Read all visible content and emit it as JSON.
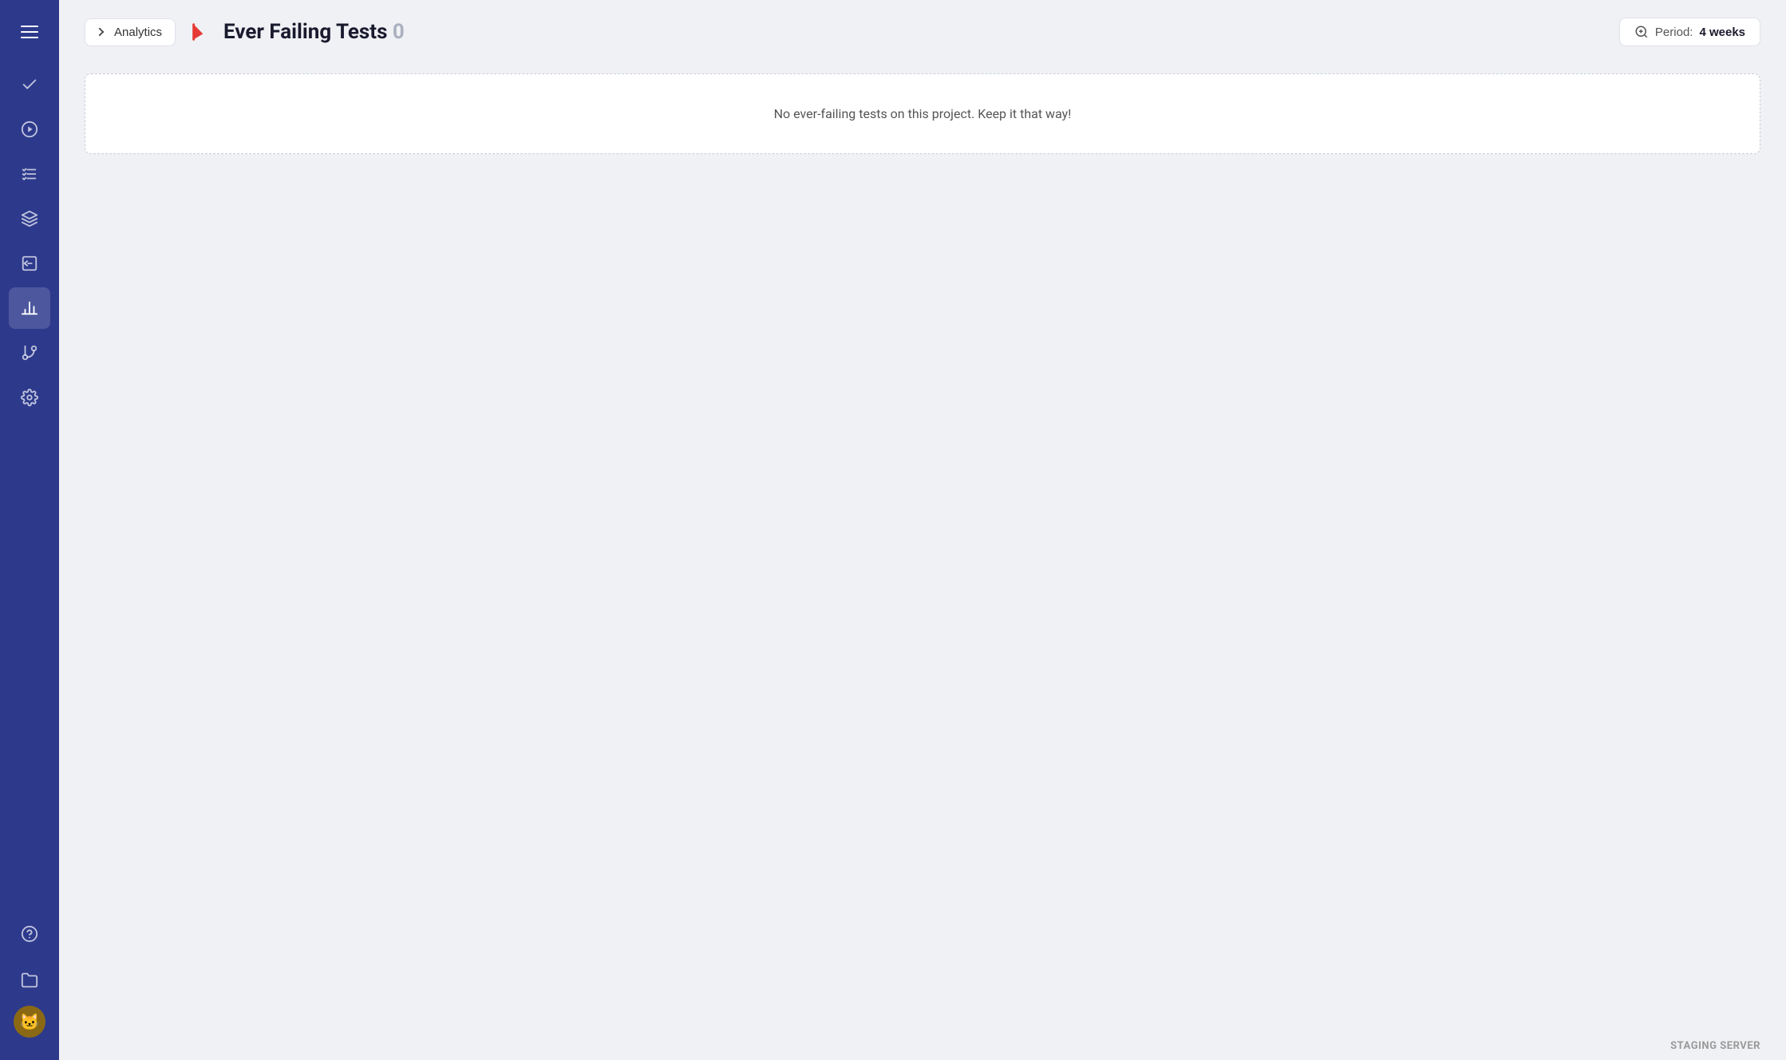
{
  "sidebar": {
    "items": [
      {
        "name": "check-icon",
        "label": "Tests",
        "active": false
      },
      {
        "name": "play-icon",
        "label": "Run",
        "active": false
      },
      {
        "name": "list-check-icon",
        "label": "Suite",
        "active": false
      },
      {
        "name": "layers-icon",
        "label": "Layers",
        "active": false
      },
      {
        "name": "terminal-icon",
        "label": "Terminal",
        "active": false
      },
      {
        "name": "bar-chart-icon",
        "label": "Analytics",
        "active": true
      },
      {
        "name": "git-branch-icon",
        "label": "Branches",
        "active": false
      },
      {
        "name": "settings-icon",
        "label": "Settings",
        "active": false
      }
    ],
    "bottom": [
      {
        "name": "help-icon",
        "label": "Help"
      },
      {
        "name": "folder-icon",
        "label": "Projects"
      }
    ]
  },
  "header": {
    "back_label": "Analytics",
    "title": "Ever Failing Tests",
    "count": "0",
    "period_label": "Period:",
    "period_value": "4 weeks"
  },
  "main": {
    "empty_message": "No ever-failing tests on this project. Keep it that way!"
  },
  "footer": {
    "label": "STAGING SERVER"
  }
}
